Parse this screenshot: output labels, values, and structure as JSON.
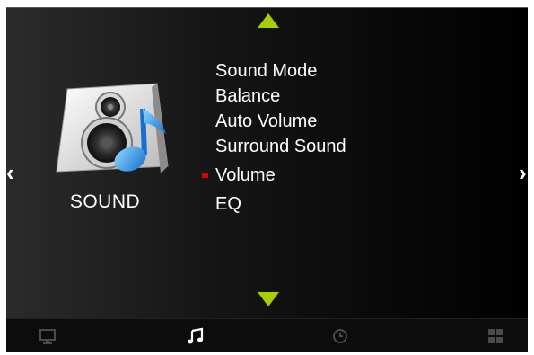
{
  "menu": {
    "title": "SOUND",
    "items": [
      {
        "label": "Sound Mode"
      },
      {
        "label": "Balance"
      },
      {
        "label": "Auto Volume"
      },
      {
        "label": "Surround Sound"
      },
      {
        "label": "Volume"
      },
      {
        "label": "EQ"
      }
    ],
    "selected_index": 4
  },
  "nav": {
    "left_arrow": "‹",
    "right_arrow": "›"
  },
  "tabs": [
    {
      "icon": "monitor-icon",
      "active": false
    },
    {
      "icon": "music-note-icon",
      "active": true
    },
    {
      "icon": "clock-icon",
      "active": false
    },
    {
      "icon": "grid-icon",
      "active": false
    }
  ],
  "colors": {
    "arrow": "#a8d000",
    "selected_marker": "#e00000",
    "text": "#ffffff"
  }
}
